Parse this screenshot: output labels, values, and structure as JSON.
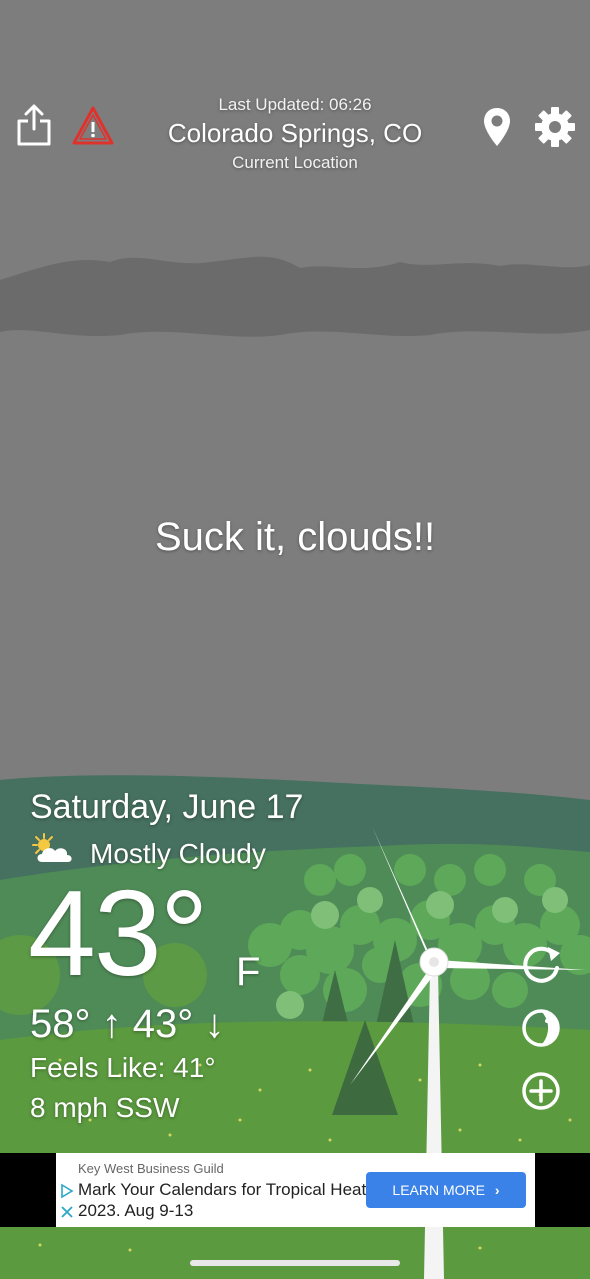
{
  "header": {
    "last_updated": "Last Updated: 06:26",
    "city": "Colorado Springs, CO",
    "location_label": "Current Location"
  },
  "tagline": "Suck it, clouds!!",
  "weather": {
    "date": "Saturday, June 17",
    "condition": "Mostly Cloudy",
    "temperature": "43°",
    "unit": "F",
    "high_low": "58° ↑ 43° ↓",
    "feels_like": "Feels Like: 41°",
    "wind": "8 mph SSW"
  },
  "ad": {
    "sponsor": "Key West Business Guild",
    "text": "Mark Your Calendars for Tropical Heat 2023. Aug 9-13",
    "cta": "LEARN MORE"
  },
  "colors": {
    "sky": "#7d7d7d",
    "alert_red": "#e0322d",
    "ad_button": "#3b82e8"
  },
  "icons": [
    "share-icon",
    "alert-icon",
    "location-pin-icon",
    "gear-icon",
    "refresh-icon",
    "theme-icon",
    "add-icon",
    "partly-cloudy-icon"
  ]
}
